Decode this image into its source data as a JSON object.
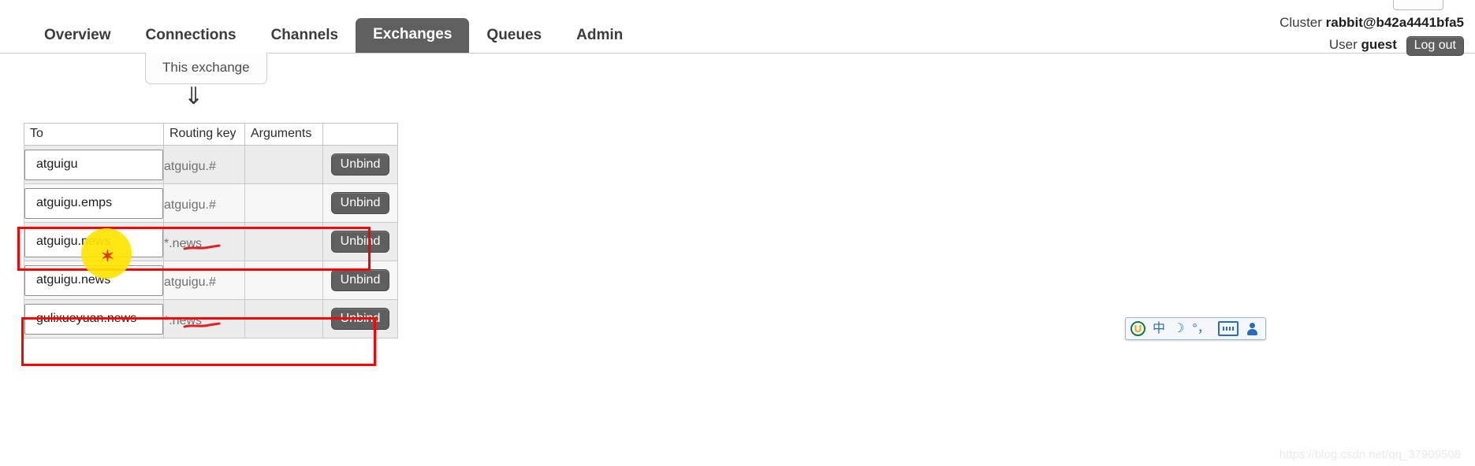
{
  "header": {
    "cluster_label": "Cluster",
    "cluster_name": "rabbit@b42a4441bfa5",
    "user_label": "User",
    "user_name": "guest",
    "logout_label": "Log out"
  },
  "nav": {
    "items": [
      {
        "label": "Overview",
        "active": false
      },
      {
        "label": "Connections",
        "active": false
      },
      {
        "label": "Channels",
        "active": false
      },
      {
        "label": "Exchanges",
        "active": true
      },
      {
        "label": "Queues",
        "active": false
      },
      {
        "label": "Admin",
        "active": false
      }
    ]
  },
  "diagram": {
    "source_label": "This exchange",
    "arrow_glyph": "⇓"
  },
  "bindings": {
    "columns": [
      "To",
      "Routing key",
      "Arguments",
      ""
    ],
    "action_label": "Unbind",
    "rows": [
      {
        "to": "atguigu",
        "routing_key": "atguigu.#",
        "arguments": "",
        "action": "Unbind",
        "annotated": false
      },
      {
        "to": "atguigu.emps",
        "routing_key": "atguigu.#",
        "arguments": "",
        "action": "Unbind",
        "annotated": false
      },
      {
        "to": "atguigu.news",
        "routing_key": "*.news",
        "arguments": "",
        "action": "Unbind",
        "annotated": true
      },
      {
        "to": "atguigu.news",
        "routing_key": "atguigu.#",
        "arguments": "",
        "action": "Unbind",
        "annotated": false
      },
      {
        "to": "gulixueyuan.news",
        "routing_key": "*.news",
        "arguments": "",
        "action": "Unbind",
        "annotated": true
      }
    ]
  },
  "annotations": {
    "highlight_color": "#ff0000",
    "cursor_color": "#ffe400",
    "cursor_marker": "✶"
  },
  "ime": {
    "logo": "U",
    "mode": "中",
    "moon": "☽",
    "punctuation": "°，",
    "keyboard": "keyboard-icon",
    "user": "user-icon"
  },
  "watermark": {
    "text": "https://blog.csdn.net/qq_37909508"
  }
}
